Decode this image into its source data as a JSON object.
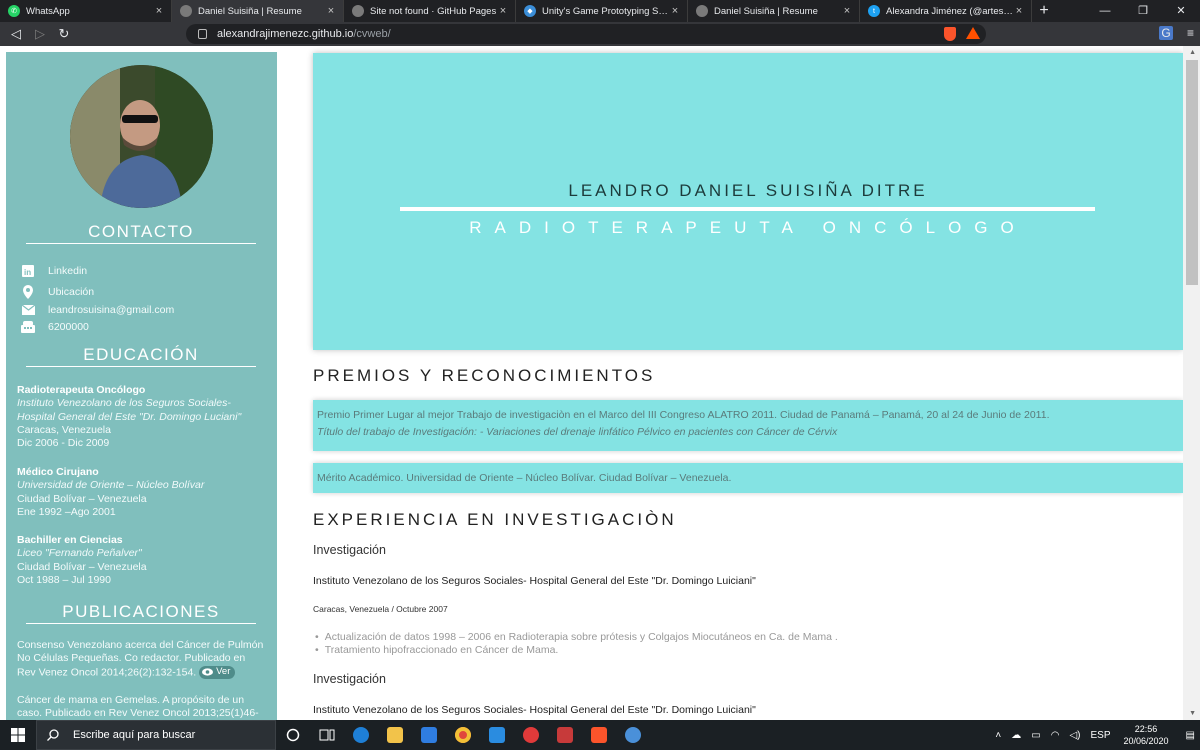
{
  "browser": {
    "tabs": [
      {
        "title": "WhatsApp",
        "favicon": "whatsapp-icon",
        "color": "#25d366",
        "active": false
      },
      {
        "title": "Daniel Suisiña | Resume",
        "favicon": "globe-icon",
        "color": "#7a7a7a",
        "active": true
      },
      {
        "title": "Site not found · GitHub Pages",
        "favicon": "globe-icon",
        "color": "#7a7a7a",
        "active": false
      },
      {
        "title": "Unity's Game Prototyping Series -",
        "favicon": "vscode-icon",
        "color": "#3b8ed8",
        "active": false
      },
      {
        "title": "Daniel Suisiña | Resume",
        "favicon": "globe-icon",
        "color": "#7a7a7a",
        "active": false
      },
      {
        "title": "Alexandra Jiménez (@artesalexj) /",
        "favicon": "twitter-icon",
        "color": "#1da1f2",
        "active": false
      }
    ],
    "url_host": "alexandrajimenezc.github.io",
    "url_path": "/cvweb/"
  },
  "sidebar": {
    "contact_title": "CONTACTO",
    "contact": [
      {
        "icon": "linkedin-icon",
        "label": "Linkedin"
      },
      {
        "icon": "location-pin-icon",
        "label": "Ubicación"
      },
      {
        "icon": "mail-icon",
        "label": "leandrosuisina@gmail.com"
      },
      {
        "icon": "phone-icon",
        "label": "6200000"
      }
    ],
    "education_title": "EDUCACIÓN",
    "education": [
      {
        "degree": "Radioterapeuta Oncólogo",
        "institution_1": "Instituto Venezolano de los Seguros Sociales-",
        "institution_2": "Hospital General del Este \"Dr. Domingo Luciani\"",
        "place": "Caracas, Venezuela",
        "dates": "Dic 2006 - Dic 2009"
      },
      {
        "degree": "Médico Cirujano",
        "institution_1": "Universidad de Oriente – Núcleo Bolívar",
        "institution_2": "",
        "place": "Ciudad Bolívar – Venezuela",
        "dates": "Ene 1992 –Ago 2001"
      },
      {
        "degree": "Bachiller en Ciencias",
        "institution_1": "Liceo \"Fernando Peñalver\"",
        "institution_2": "",
        "place": "Ciudad Bolívar – Venezuela",
        "dates": "Oct 1988 – Jul 1990"
      }
    ],
    "publications_title": "PUBLICACIONES",
    "publications": [
      {
        "lines": [
          "Consenso Venezolano acerca del Cáncer de Pulmón",
          "No Células Pequeñas. Co redactor. Publicado en",
          "Rev Venez Oncol 2014;26(2):132-154."
        ],
        "button": "Ver"
      },
      {
        "lines": [
          "Cáncer de mama en Gemelas. A propósito de un",
          "caso. Publicado en Rev Venez Oncol 2013;25(1)46-"
        ],
        "button": ""
      }
    ]
  },
  "hero": {
    "name": "LEANDRO DANIEL SUISIÑA DITRE",
    "subtitle": "RADIOTERAPEUTA ONCÓLOGO",
    "bg_color": "#84e3e3"
  },
  "awards": {
    "title": "PREMIOS Y RECONOCIMIENTOS",
    "items": [
      {
        "line1": "Premio Primer Lugar al mejor Trabajo de investigaciòn en el Marco del III Congreso ALATRO 2011. Ciudad de Panamá – Panamá, 20 al 24 de Junio de 2011.",
        "line2_label": "Título del trabajo de Investigación:",
        "line2_text": " - Variaciones del drenaje linfático Pélvico en pacientes con Cáncer de Cérvix"
      },
      {
        "line1": "Mérito Académico. Universidad de Oriente – Núcleo Bolívar. Ciudad Bolívar – Venezuela."
      }
    ]
  },
  "research": {
    "title": "EXPERIENCIA EN INVESTIGACIÒN",
    "entries": [
      {
        "heading": "Investigación",
        "institution": "Instituto Venezolano de los Seguros Sociales- Hospital General del Este \"Dr. Domingo Luiciani\"",
        "location_date": "Caracas, Venezuela / Octubre 2007",
        "items": [
          "Actualización de datos 1998 – 2006 en Radioterapia sobre prótesis y Colgajos Miocutáneos en Ca. de Mama .",
          "Tratamiento hipofraccionado en Cáncer de Mama."
        ]
      },
      {
        "heading": "Investigación",
        "institution": "Instituto Venezolano de los Seguros Sociales- Hospital General del Este \"Dr. Domingo Luiciani\""
      }
    ]
  },
  "taskbar": {
    "search_placeholder": "Escribe aquí para buscar",
    "time": "22:56",
    "date": "20/06/2020"
  }
}
